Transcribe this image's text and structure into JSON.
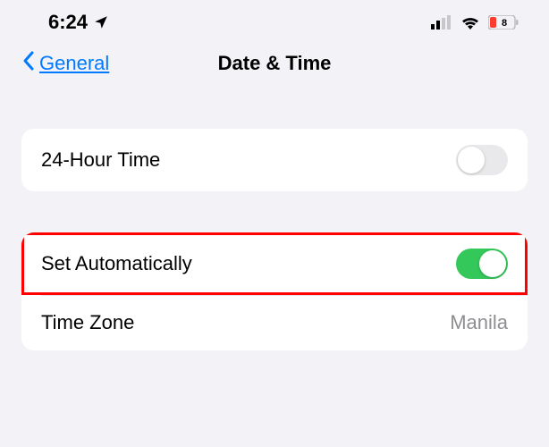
{
  "status": {
    "time": "6:24",
    "battery_level": "8"
  },
  "nav": {
    "back_label": "General",
    "title": "Date & Time"
  },
  "group1": {
    "row1_label": "24-Hour Time",
    "row1_toggle": false
  },
  "group2": {
    "row1_label": "Set Automatically",
    "row1_toggle": true,
    "row2_label": "Time Zone",
    "row2_value": "Manila"
  },
  "colors": {
    "accent": "#007aff",
    "toggle_on": "#34c759",
    "highlight": "#ff0000"
  }
}
